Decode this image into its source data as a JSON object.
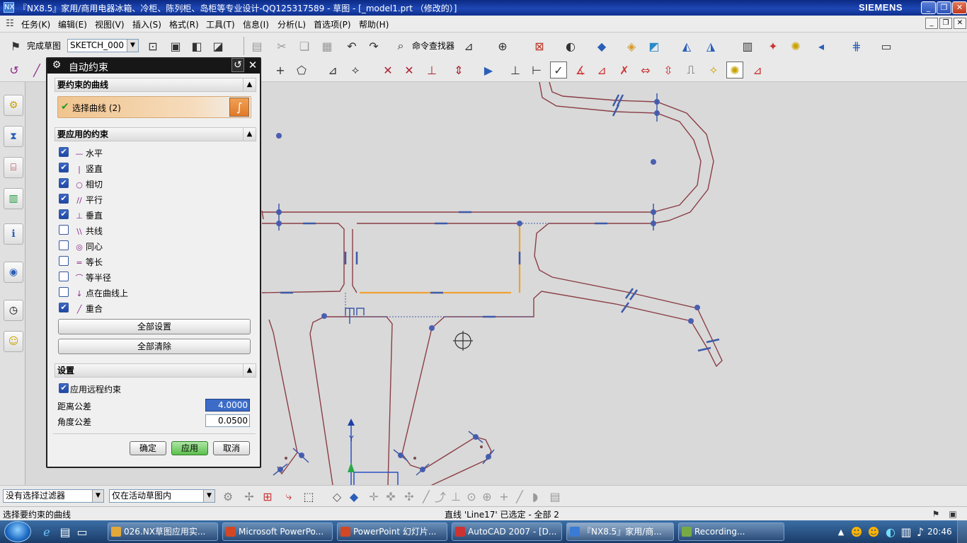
{
  "window": {
    "title": "『NX8.5』家用/商用电器冰箱、冷柜、陈列柜、岛柜等专业设计-QQ125317589 - 草图 - [_model1.prt （修改的）]",
    "brand": "SIEMENS",
    "app_logo": "NX"
  },
  "menu": [
    "任务(K)",
    "编辑(E)",
    "视图(V)",
    "插入(S)",
    "格式(R)",
    "工具(T)",
    "信息(I)",
    "分析(L)",
    "首选项(P)",
    "帮助(H)"
  ],
  "toolbar1": {
    "finish_sketch": "完成草图",
    "sketch_name": "SKETCH_000",
    "command_finder": "命令查找器"
  },
  "dialog": {
    "title": "自动约束",
    "section_curves": "要约束的曲线",
    "select_curve": "选择曲线 (2)",
    "section_constraints": "要应用的约束",
    "constraints": [
      {
        "label": "水平",
        "checked": true,
        "icon": "—"
      },
      {
        "label": "竖直",
        "checked": true,
        "icon": "|"
      },
      {
        "label": "相切",
        "checked": true,
        "icon": "○"
      },
      {
        "label": "平行",
        "checked": true,
        "icon": "//"
      },
      {
        "label": "垂直",
        "checked": true,
        "icon": "⊥"
      },
      {
        "label": "共线",
        "checked": false,
        "icon": "\\\\"
      },
      {
        "label": "同心",
        "checked": false,
        "icon": "◎"
      },
      {
        "label": "等长",
        "checked": false,
        "icon": "="
      },
      {
        "label": "等半径",
        "checked": false,
        "icon": "⌒"
      },
      {
        "label": "点在曲线上",
        "checked": false,
        "icon": "↓"
      },
      {
        "label": "重合",
        "checked": true,
        "icon": "╱"
      }
    ],
    "set_all": "全部设置",
    "clear_all": "全部清除",
    "section_settings": "设置",
    "apply_remote": "应用远程约束",
    "distance_tol_label": "距离公差",
    "distance_tol": "4.0000",
    "angle_tol_label": "角度公差",
    "angle_tol": "0.0500",
    "ok": "确定",
    "apply": "应用",
    "cancel": "取消"
  },
  "bottom": {
    "filter": "没有选择过滤器",
    "scope": "仅在活动草图内"
  },
  "status": {
    "prompt": "选择要约束的曲线",
    "selection": "直线 'Line17' 已选定 - 全部 2"
  },
  "taskbar": {
    "items": [
      "026.NX草图应用实...",
      "Microsoft PowerPo...",
      "PowerPoint 幻灯片...",
      "AutoCAD 2007 - [D...",
      "『NX8.5』家用/商...",
      "Recording..."
    ],
    "clock": "20:46"
  }
}
